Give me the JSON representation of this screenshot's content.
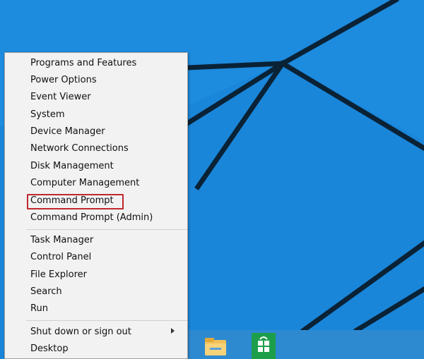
{
  "menu": {
    "items": [
      {
        "label": "Programs and Features"
      },
      {
        "label": "Power Options"
      },
      {
        "label": "Event Viewer"
      },
      {
        "label": "System"
      },
      {
        "label": "Device Manager"
      },
      {
        "label": "Network Connections"
      },
      {
        "label": "Disk Management"
      },
      {
        "label": "Computer Management"
      },
      {
        "label": "Command Prompt"
      },
      {
        "label": "Command Prompt (Admin)"
      },
      {
        "label": "Task Manager"
      },
      {
        "label": "Control Panel"
      },
      {
        "label": "File Explorer"
      },
      {
        "label": "Search"
      },
      {
        "label": "Run"
      },
      {
        "label": "Shut down or sign out"
      },
      {
        "label": "Desktop"
      }
    ],
    "highlighted_item": "Command Prompt"
  },
  "taskbar": {
    "pinned_icons": [
      "file-explorer-icon",
      "store-icon"
    ]
  },
  "colors": {
    "desktop_blue": "#1a86d9",
    "highlight_red": "#c0282d",
    "menu_background": "#f2f2f2"
  }
}
